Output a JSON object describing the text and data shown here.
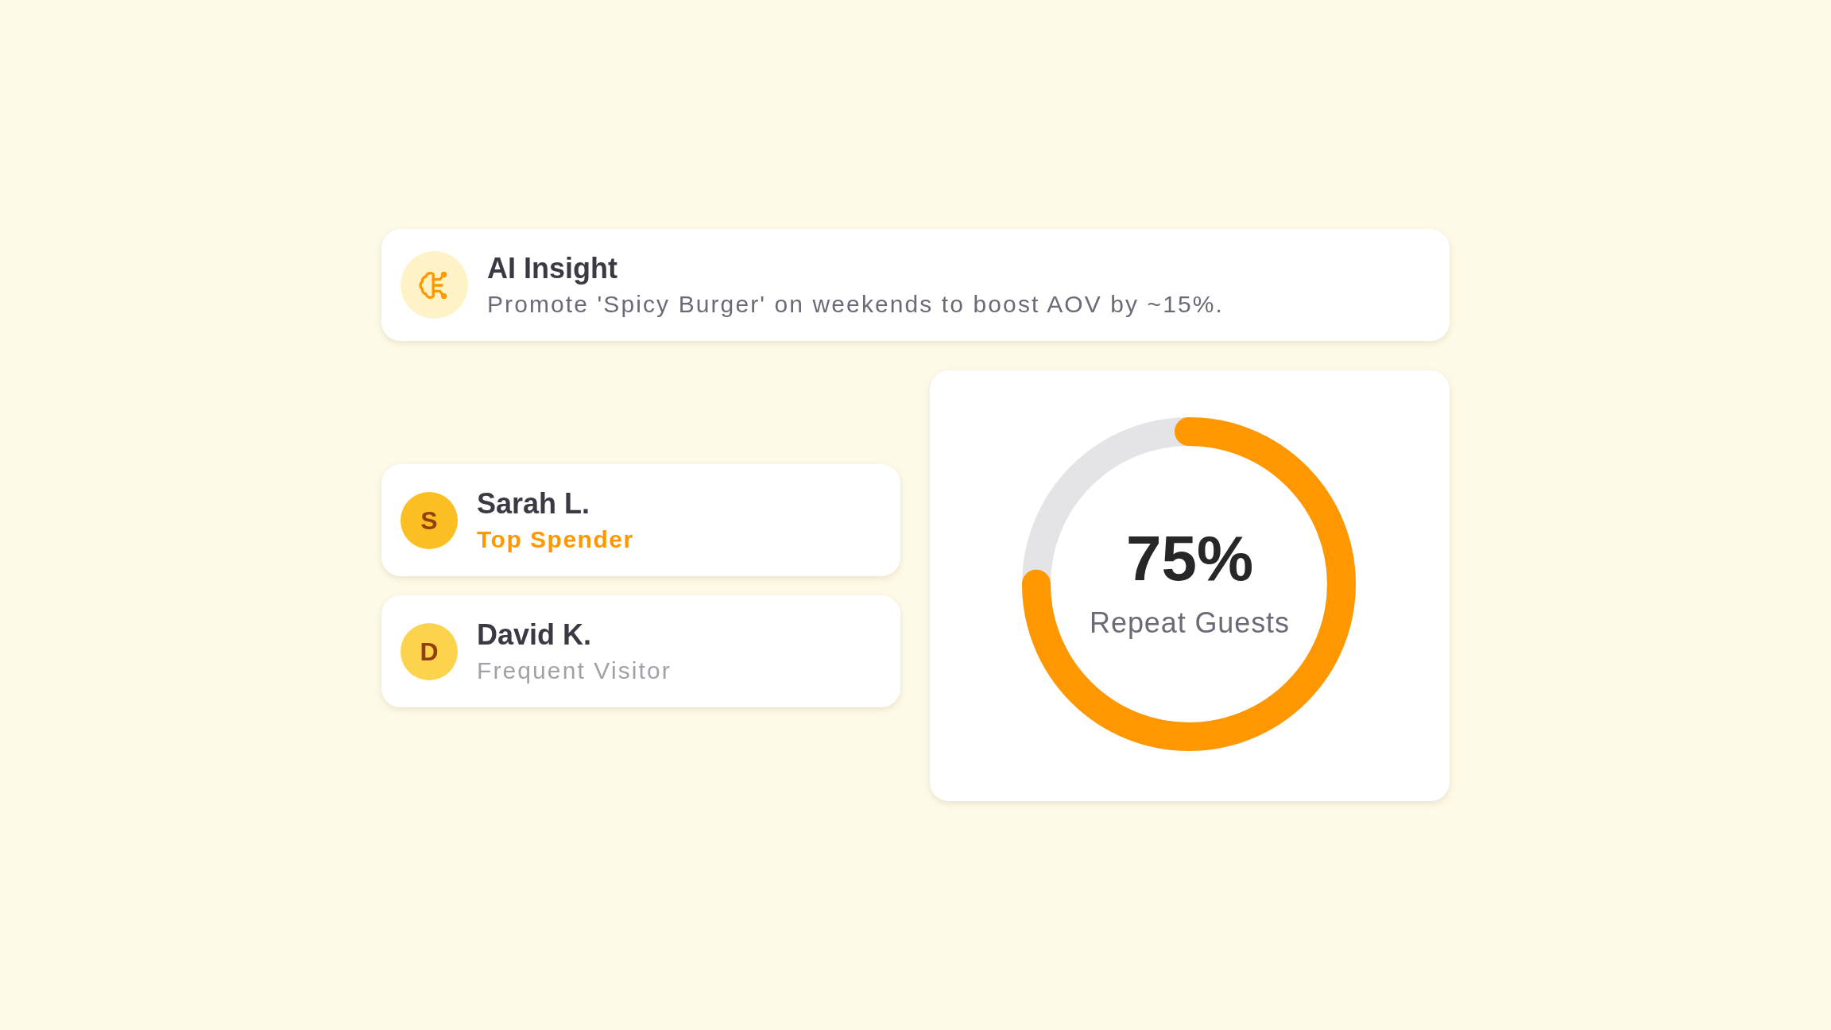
{
  "insight": {
    "title": "AI Insight",
    "message": "Promote 'Spicy Burger' on weekends to boost AOV by ~15%."
  },
  "customers": [
    {
      "initial": "S",
      "name": "Sarah L.",
      "tag": "Top Spender",
      "highlighted": true,
      "color": "#fbbf24"
    },
    {
      "initial": "D",
      "name": "David K.",
      "tag": "Frequent Visitor",
      "highlighted": false,
      "color": "#fcd34d"
    }
  ],
  "meter": {
    "reading": "75%",
    "label": "Repeat Guests"
  }
}
